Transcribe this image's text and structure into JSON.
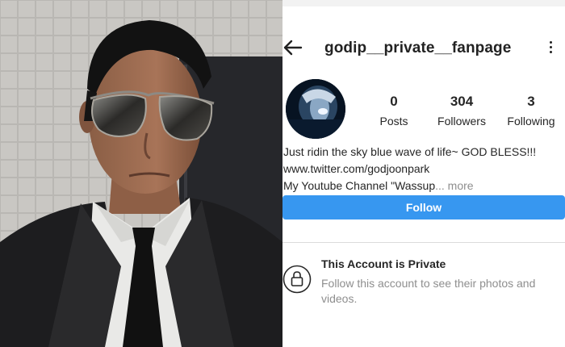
{
  "profile": {
    "username": "godip__private__fanpage",
    "stats": [
      {
        "value": "0",
        "label": "Posts"
      },
      {
        "value": "304",
        "label": "Followers"
      },
      {
        "value": "3",
        "label": "Following"
      }
    ],
    "bio": {
      "line1": "Just ridin the sky blue wave of life~ GOD BLESS!!!",
      "line2": "www.twitter.com/godjoonpark",
      "line3": "My Youtube Channel \"Wassup",
      "ellipsis": "...",
      "more": " more"
    },
    "follow_label": "Follow"
  },
  "private_notice": {
    "title": "This Account is Private",
    "text": "Follow this account to see their photos and videos."
  },
  "icons": {
    "back": "arrow-left-icon",
    "menu": "more-vertical-icon",
    "lock": "lock-icon"
  },
  "colors": {
    "follow_button": "#3797f0",
    "text": "#262626",
    "muted": "#8e8e8e"
  }
}
